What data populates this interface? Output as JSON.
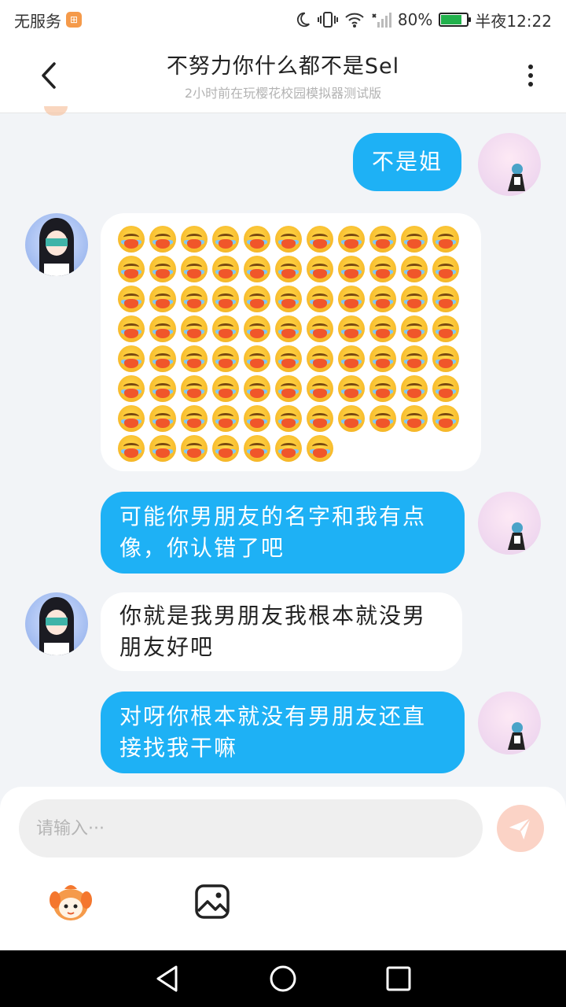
{
  "status_bar": {
    "carrier": "无服务",
    "battery_percent": "80%",
    "battery_level": 0.8,
    "time": "半夜12:22"
  },
  "header": {
    "title": "不努力你什么都不是Sel",
    "subtitle": "2小时前在玩樱花校园模拟器测试版"
  },
  "messages": [
    {
      "sender": "me",
      "text": "不是姐"
    },
    {
      "sender": "other",
      "type": "emoji",
      "emoji_icon": "crying-emoji-icon",
      "emoji_count": 84
    },
    {
      "sender": "me",
      "text": "可能你男朋友的名字和我有点像，你认错了吧"
    },
    {
      "sender": "other",
      "text": "你就是我男朋友我根本就没男朋友好吧"
    },
    {
      "sender": "me",
      "text": "对呀你根本就没有男朋友还直接找我干嘛"
    }
  ],
  "input": {
    "placeholder": "请输入···",
    "value": ""
  },
  "colors": {
    "my_bubble": "#1eb1f5",
    "other_bubble": "#ffffff",
    "send_button": "#fbd3c6",
    "background": "#f2f4f7"
  },
  "icons": {
    "back": "back-arrow-icon",
    "more": "more-vertical-icon",
    "send": "paper-plane-icon",
    "emoji_tool": "mascot-emoji-icon",
    "image_tool": "image-icon"
  }
}
